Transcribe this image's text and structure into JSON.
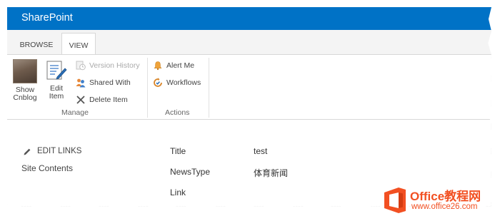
{
  "app": {
    "title": "SharePoint"
  },
  "tabs": [
    {
      "label": "BROWSE"
    },
    {
      "label": "VIEW"
    }
  ],
  "ribbon": {
    "manage": {
      "label": "Manage",
      "show_line1": "Show",
      "show_line2": "Cnblog",
      "edit_line1": "Edit",
      "edit_line2": "Item",
      "version_history": "Version History",
      "shared_with": "Shared With",
      "delete_item": "Delete Item"
    },
    "actions": {
      "label": "Actions",
      "alert_me": "Alert Me",
      "workflows": "Workflows"
    }
  },
  "leftnav": {
    "edit_links": "EDIT LINKS",
    "site_contents": "Site Contents"
  },
  "item": {
    "fields": [
      {
        "name": "Title",
        "value": "test"
      },
      {
        "name": "NewsType",
        "value": "体育新闻"
      },
      {
        "name": "Link",
        "value": ""
      }
    ]
  },
  "watermark": {
    "brand": "Office教程网",
    "url": "www.office26.com"
  },
  "colors": {
    "suite_bar": "#0072c6",
    "logo_orange": "#f25022"
  }
}
